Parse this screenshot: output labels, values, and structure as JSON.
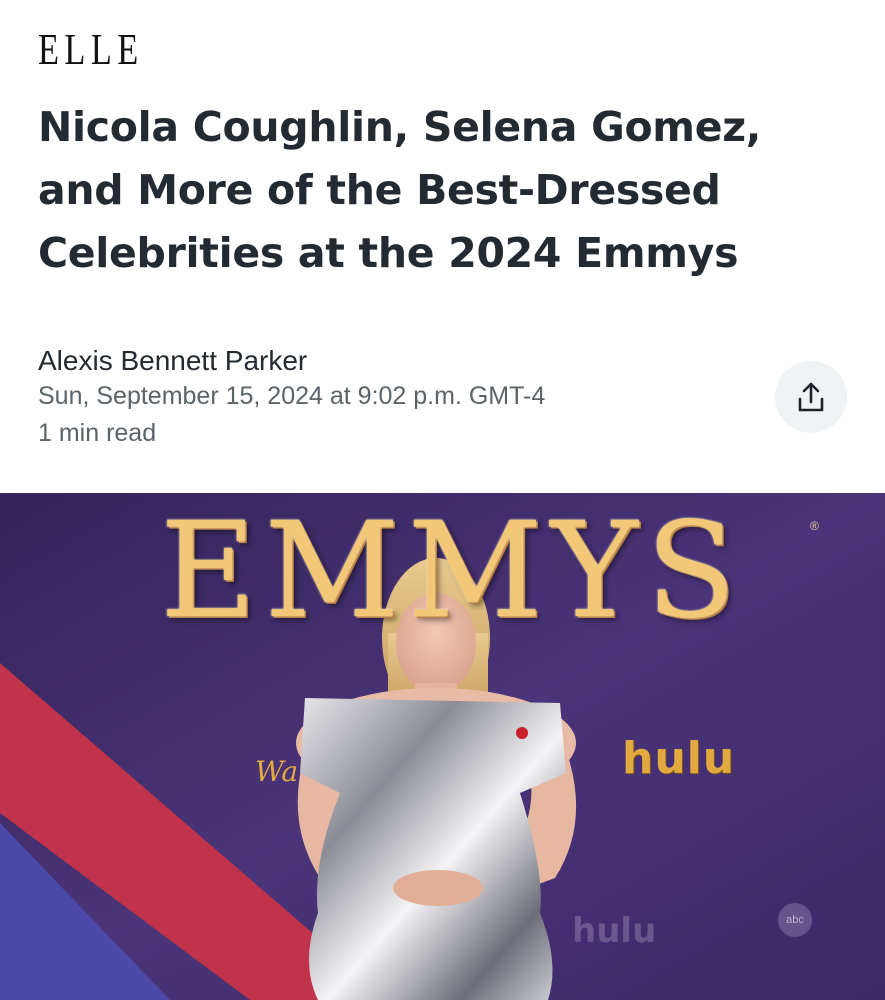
{
  "brand": {
    "logo_text": "ELLE"
  },
  "article": {
    "headline": "Nicola Coughlin, Selena Gomez, and More of the Best-Dressed Celebrities at the 2024 Emmys",
    "author": "Alexis Bennett Parker",
    "published": "Sun, September 15, 2024 at 9:02 p.m. GMT-4",
    "read_time": "1 min read"
  },
  "share": {
    "icon": "share-upload-icon"
  },
  "hero_image": {
    "backdrop_text": "EMMYS",
    "registered_mark": "®",
    "sponsor_logo": "hulu",
    "sponsor_logo_faint": "hulu",
    "network_logo": "abc",
    "partial_logo": "Wa",
    "colors": {
      "backdrop": "#3e2d6e",
      "stripe": "#c0334a",
      "gold": "#f2c878"
    }
  }
}
